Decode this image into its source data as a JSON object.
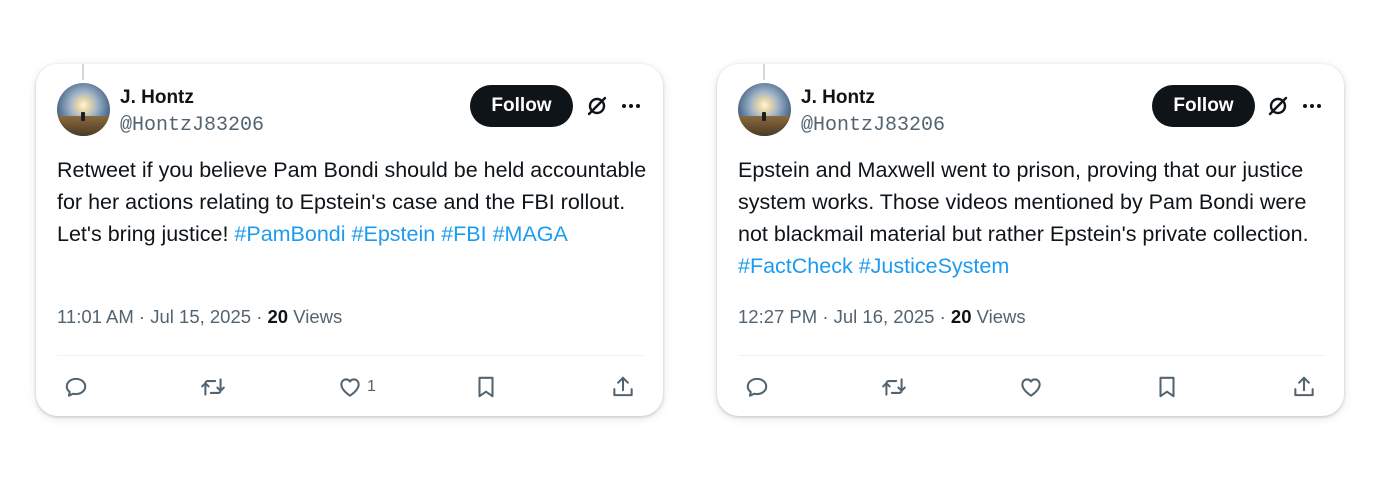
{
  "tweets": [
    {
      "author_name": "J. Hontz",
      "handle": "@HontzJ83206",
      "follow_label": "Follow",
      "text_main": "Retweet if you believe Pam Bondi should be held accountable for her actions relating to Epstein's case and the FBI rollout. Let's bring justice! ",
      "hashtags": [
        "#PamBondi",
        "#Epstein",
        "#FBI",
        "#MAGA"
      ],
      "time": "11:01 AM",
      "date": "Jul 15, 2025",
      "views_count": "20",
      "views_label": "Views",
      "like_count": "1",
      "icons": [
        "reply-icon",
        "retweet-icon",
        "heart-icon",
        "bookmark-icon",
        "share-icon",
        "grok-icon",
        "more-icon"
      ]
    },
    {
      "author_name": "J. Hontz",
      "handle": "@HontzJ83206",
      "follow_label": "Follow",
      "text_main": "Epstein and Maxwell went to prison, proving that our justice system works. Those videos mentioned by Pam Bondi were not blackmail material but rather Epstein's private collection. ",
      "hashtags": [
        "#FactCheck",
        "#JusticeSystem"
      ],
      "time": "12:27 PM",
      "date": "Jul 16, 2025",
      "views_count": "20",
      "views_label": "Views",
      "like_count": "",
      "icons": [
        "reply-icon",
        "retweet-icon",
        "heart-icon",
        "bookmark-icon",
        "share-icon",
        "grok-icon",
        "more-icon"
      ]
    }
  ],
  "colors": {
    "link": "#1d9bf0",
    "secondary_text": "#536471",
    "follow_button": "#0f1419"
  }
}
